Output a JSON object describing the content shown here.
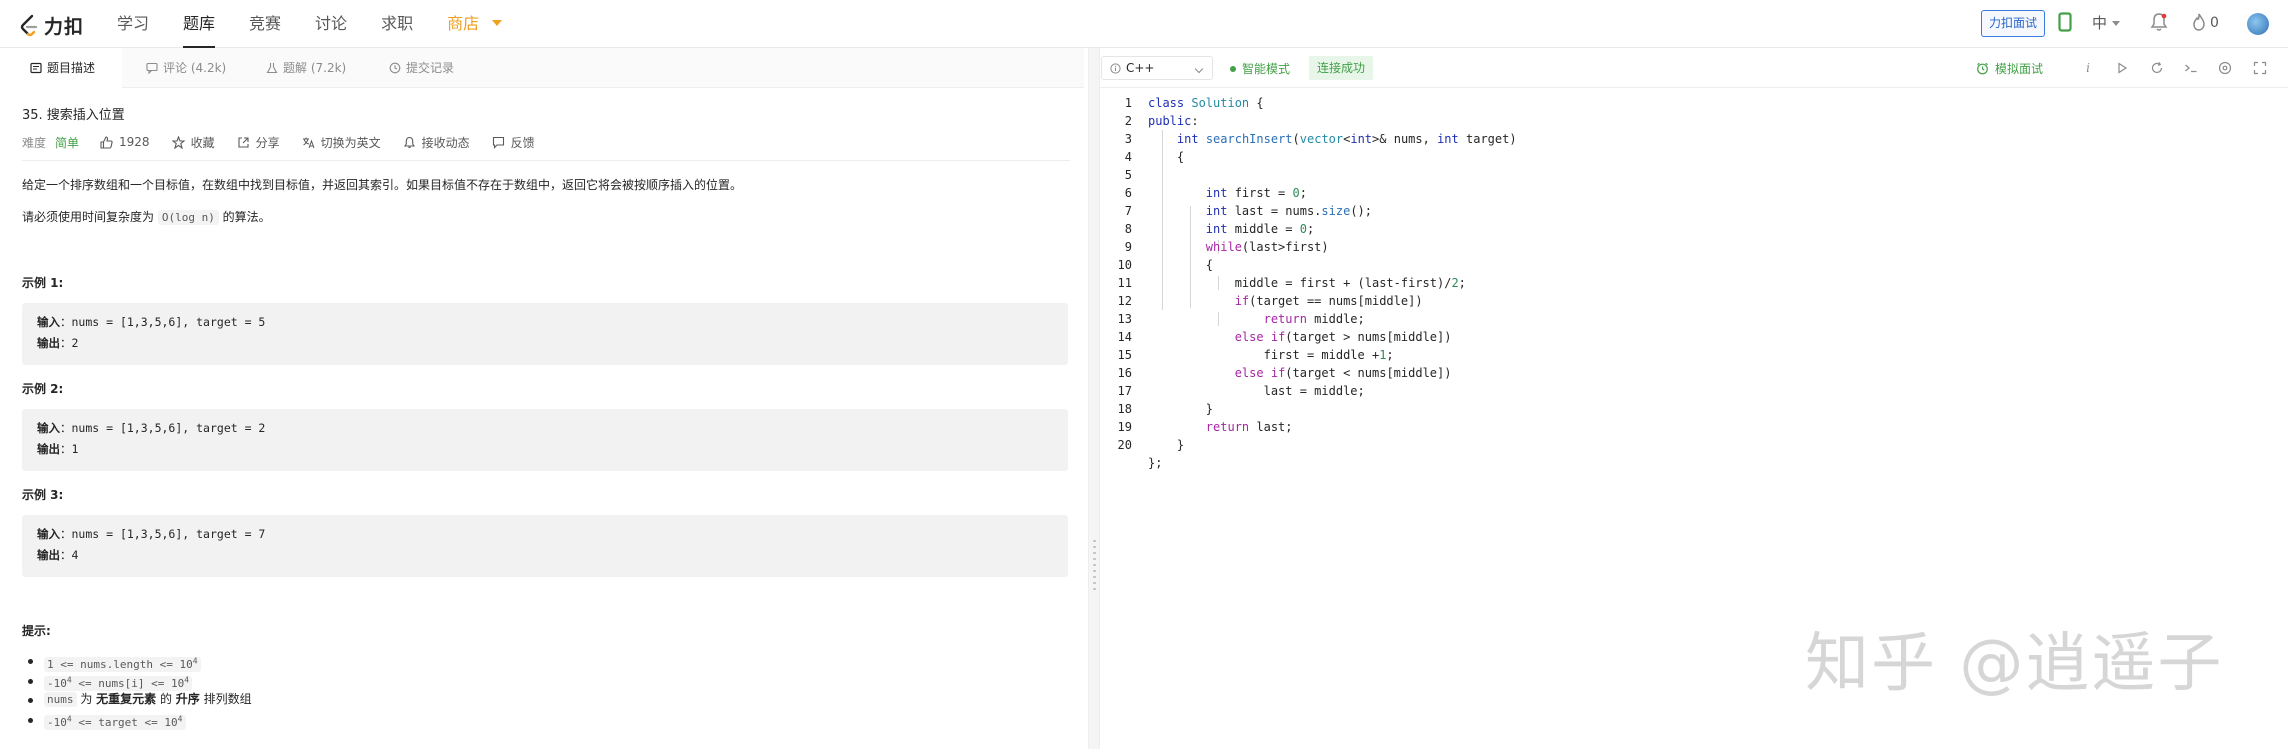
{
  "nav": {
    "logo_text": "力扣",
    "items": [
      {
        "label": "学习"
      },
      {
        "label": "题库"
      },
      {
        "label": "竞赛"
      },
      {
        "label": "讨论"
      },
      {
        "label": "求职"
      },
      {
        "label": "商店"
      }
    ],
    "interview_button": "力扣面试",
    "language": "中",
    "points": "0"
  },
  "left_tabs": [
    {
      "label": "题目描述"
    },
    {
      "label": "评论 (4.2k)"
    },
    {
      "label": "题解 (7.2k)"
    },
    {
      "label": "提交记录"
    }
  ],
  "problem": {
    "title": "35. 搜索插入位置",
    "difficulty_label": "难度",
    "difficulty": "简单",
    "likes": "1928",
    "favorite": "收藏",
    "share": "分享",
    "switch_english": "切换为英文",
    "subscribe": "接收动态",
    "feedback": "反馈",
    "desc1": "给定一个排序数组和一个目标值，在数组中找到目标值，并返回其索引。如果目标值不存在于数组中，返回它将会被按顺序插入的位置。",
    "desc2_before": "请必须使用时间复杂度为",
    "desc2_code": "O(log n)",
    "desc2_after": "的算法。",
    "examples": [
      {
        "title": "示例 1:",
        "input_label": "输入",
        "input": "：nums = [1,3,5,6], target = 5",
        "output_label": "输出",
        "output": "：2"
      },
      {
        "title": "示例 2:",
        "input_label": "输入",
        "input": "：nums = [1,3,5,6], target = 2",
        "output_label": "输出",
        "output": "：1"
      },
      {
        "title": "示例 3:",
        "input_label": "输入",
        "input": "：nums = [1,3,5,6], target = 7",
        "output_label": "输出",
        "output": "：4"
      }
    ],
    "hint_title": "提示:",
    "hints": {
      "h1": "1 <= nums.length <= 10",
      "h1_sup": "4",
      "h2a": "-10",
      "h2a_sup": "4",
      "h2b": " <= nums[i] <= 10",
      "h2b_sup": "4",
      "h3_code": "nums",
      "h3_mid": " 为 ",
      "h3_bold1": "无重复元素",
      "h3_mid2": " 的 ",
      "h3_bold2": "升序",
      "h3_end": " 排列数组",
      "h4a": "-10",
      "h4a_sup": "4",
      "h4b": " <= target <= 10",
      "h4b_sup": "4"
    }
  },
  "editor": {
    "language": "C++",
    "smart_mode": "智能模式",
    "connection": "连接成功",
    "mock_interview": "模拟面试",
    "line_numbers": [
      "1",
      "2",
      "3",
      "4",
      "5",
      "6",
      "7",
      "8",
      "9",
      "10",
      "11",
      "12",
      "13",
      "14",
      "15",
      "16",
      "17",
      "18",
      "19",
      "20"
    ]
  },
  "watermark": "知乎 @逍遥子",
  "colors": {
    "accent_green": "#43a047",
    "store_orange": "#f0a020",
    "interview_blue": "#2a66c7"
  }
}
